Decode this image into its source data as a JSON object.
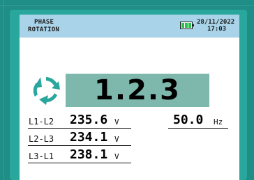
{
  "header": {
    "title_line1": "PHASE",
    "title_line2": "ROTATION",
    "date": "28/11/2022",
    "time": "17:03",
    "battery_icon": "battery-full-icon",
    "battery_color": "#27c04a"
  },
  "rotation": {
    "icon": "rotation-arrows-icon",
    "sequence": "1.2.3",
    "icon_color": "#2aa79d",
    "box_color": "#7eb8ad"
  },
  "measurements": [
    {
      "label": "L1-L2",
      "value": "235.6",
      "unit": "V"
    },
    {
      "label": "L2-L3",
      "value": "234.1",
      "unit": "V"
    },
    {
      "label": "L3-L1",
      "value": "238.1",
      "unit": "V"
    }
  ],
  "frequency": {
    "value": "50.0",
    "unit": "Hz"
  },
  "colors": {
    "bezel": "#2aa79d",
    "header_bar": "#a9d3e8",
    "background": "#1f8e86"
  }
}
